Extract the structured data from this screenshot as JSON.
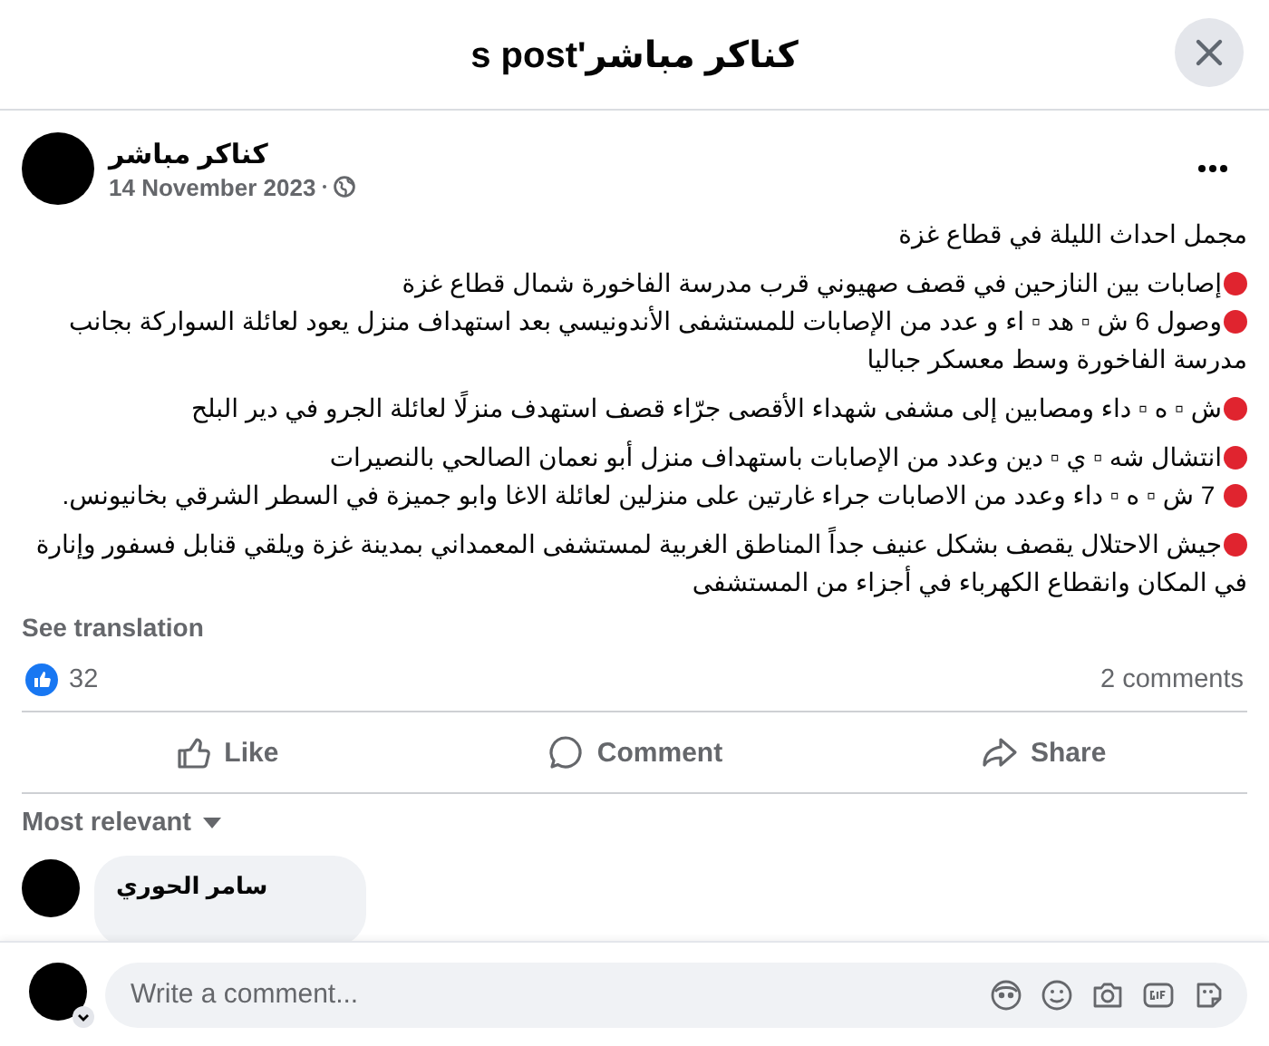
{
  "dialog": {
    "title": "كناكر مباشر's post"
  },
  "post": {
    "author": "كناكر مباشر",
    "date": "14 November 2023",
    "paragraphs": [
      {
        "bullet": false,
        "text": "مجمل احداث الليلة في قطاع غزة"
      },
      {
        "bullet": true,
        "text": "إصابات بين النازحين في قصف صهيوني قرب مدرسة الفاخورة شمال قطاع غزة"
      },
      {
        "bullet": true,
        "text": "وصول 6 ش ▫ هد ▫ اء و عدد من الإصابات للمستشفى الأندونيسي بعد استهداف منزل يعود لعائلة السواركة بجانب مدرسة الفاخورة وسط معسكر جباليا"
      },
      {
        "bullet": true,
        "text": "ش ▫ ه ▫ داء ومصابين إلى مشفى شهداء الأقصى جرّاء قصف استهدف منزلًا لعائلة الجرو في دير البلح"
      },
      {
        "bullet": true,
        "text": "انتشال شه ▫ ي ▫ دين وعدد من الإصابات باستهداف منزل أبو نعمان الصالحي بالنصيرات"
      },
      {
        "bullet": true,
        "text": " 7 ش ▫ ه ▫ داء وعدد من الاصابات جراء غارتين على منزلين لعائلة الاغا وابو جميزة في السطر الشرقي بخانيونس."
      },
      {
        "bullet": true,
        "text": "جيش الاحتلال يقصف بشكل عنيف جداً المناطق الغربية لمستشفى المعمداني بمدينة غزة ويلقي قنابل فسفور وإنارة في المكان وانقطاع الكهرباء في أجزاء من المستشفى"
      }
    ],
    "see_translation": "See translation",
    "likes": "32",
    "comments_count": "2 comments",
    "actions": {
      "like": "Like",
      "comment": "Comment",
      "share": "Share"
    }
  },
  "comments": {
    "sort": "Most relevant",
    "items": [
      {
        "author": "سامر الحوري"
      }
    ]
  },
  "composer": {
    "placeholder": "Write a comment..."
  }
}
